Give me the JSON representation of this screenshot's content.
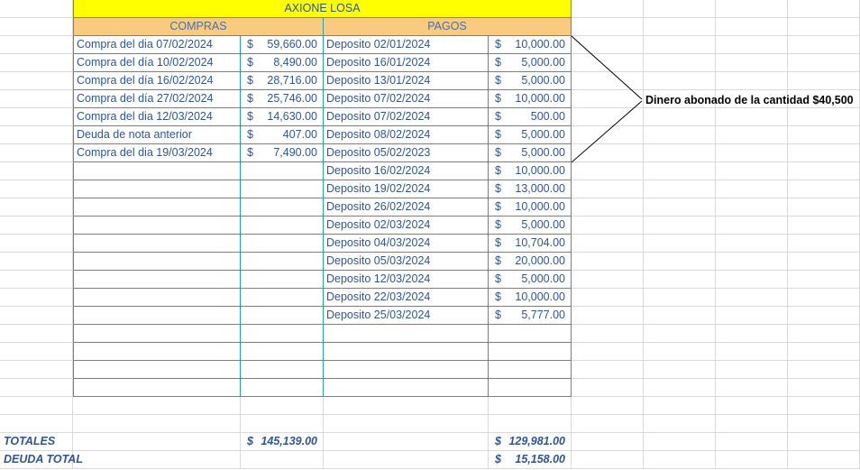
{
  "title": "AXIONE LOSA",
  "headers": {
    "compras": "COMPRAS",
    "pagos": "PAGOS"
  },
  "currency": "$",
  "compras": [
    {
      "desc": "Compra del dia 07/02/2024",
      "amount": "59,660.00"
    },
    {
      "desc": "Compra del día 10/02/2024",
      "amount": "8,490.00"
    },
    {
      "desc": "Compra del día 16/02/2024",
      "amount": "28,716.00"
    },
    {
      "desc": "Compra del día 27/02/2024",
      "amount": "25,746.00"
    },
    {
      "desc": "Compra del dia 12/03/2024",
      "amount": "14,630.00"
    },
    {
      "desc": "Deuda de nota anterior",
      "amount": "407.00"
    },
    {
      "desc": "Compra del dia 19/03/2024",
      "amount": "7,490.00"
    }
  ],
  "pagos": [
    {
      "desc": "Deposito 02/01/2024",
      "amount": "10,000.00"
    },
    {
      "desc": "Deposito 16/01/2024",
      "amount": "5,000.00"
    },
    {
      "desc": "Deposito 13/01/2024",
      "amount": "5,000.00"
    },
    {
      "desc": "Deposito 07/02/2024",
      "amount": "10,000.00"
    },
    {
      "desc": "Deposito 07/02/2024",
      "amount": "500.00"
    },
    {
      "desc": "Deposito 08/02/2024",
      "amount": "5,000.00"
    },
    {
      "desc": "Deposito 05/02/2023",
      "amount": "5,000.00"
    },
    {
      "desc": "Deposito 16/02/2024",
      "amount": "10,000.00"
    },
    {
      "desc": "Deposito 19/02/2024",
      "amount": "13,000.00"
    },
    {
      "desc": "Deposito 26/02/2024",
      "amount": "10,000.00"
    },
    {
      "desc": "Deposito 02/03/2024",
      "amount": "5,000.00"
    },
    {
      "desc": "Deposito 04/03/2024",
      "amount": "10,704.00"
    },
    {
      "desc": "Deposito 05/03/2024",
      "amount": "20,000.00"
    },
    {
      "desc": "Deposito 12/03/2024",
      "amount": "5,000.00"
    },
    {
      "desc": "Deposito 22/03/2024",
      "amount": "10,000.00"
    },
    {
      "desc": "Deposito 25/03/2024",
      "amount": "5,777.00"
    }
  ],
  "totals": {
    "label": "TOTALES",
    "compras_total": "145,139.00",
    "pagos_total": "129,981.00",
    "deuda_label": "DEUDA TOTAL",
    "deuda_total": "15,158.00"
  },
  "note": "Dinero abonado de la cantidad $40,500"
}
